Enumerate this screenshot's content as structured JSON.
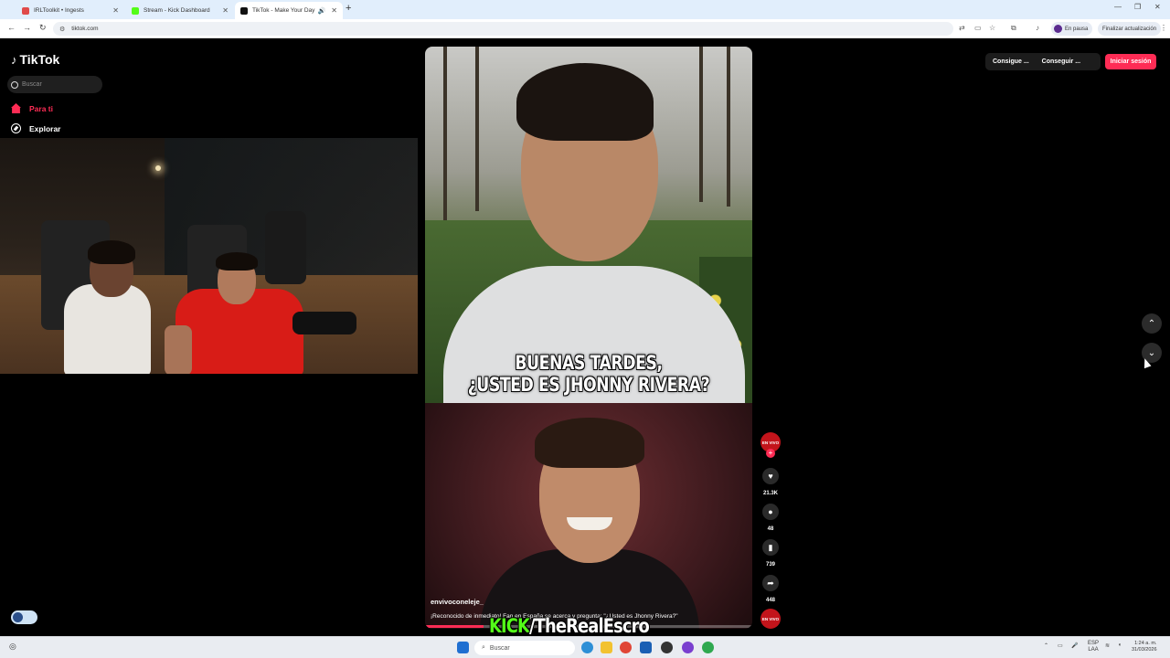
{
  "browser": {
    "tabs": [
      {
        "title": "IRLToolkit • Ingests",
        "color": "#e04a4a"
      },
      {
        "title": "Stream - Kick Dashboard",
        "color": "#53fc18"
      },
      {
        "title": "TikTok - Make Your Day",
        "color": "#111111"
      }
    ],
    "url": "tiktok.com",
    "profile_status": "En pausa",
    "update_label": "Finalizar actualización"
  },
  "tiktok": {
    "logo": "TikTok",
    "search_placeholder": "Buscar",
    "nav": [
      {
        "label": "Para ti",
        "color": "#fe2c55"
      },
      {
        "label": "Explorar",
        "color": "#ffffff"
      }
    ],
    "top_buttons": [
      "Consigue ...",
      "Conseguir ..."
    ],
    "login_label": "Iniciar sesión",
    "video": {
      "caption_line1": "BUENAS TARDES,",
      "caption_line2": "¿USTED ES JHONNY RIVERA?",
      "author": "envivoconeleje_",
      "description": "¡Reconocido de inmediato! Fan en España se acerca y pregunta: \"¿Usted es Jhonny Rivera?\"",
      "progress_fraction": 0.18
    },
    "actions": {
      "live_label": "EN VIVO",
      "likes": "21.3K",
      "comments": "48",
      "saves": "739",
      "shares": "448"
    }
  },
  "overlay": {
    "kick_word": "KICK",
    "channel": "/TheRealEscro"
  },
  "taskbar": {
    "search_placeholder": "Buscar",
    "lang_top": "ESP",
    "lang_bottom": "LAA",
    "time": "1:24 a. m.",
    "date": "31/03/2026"
  }
}
